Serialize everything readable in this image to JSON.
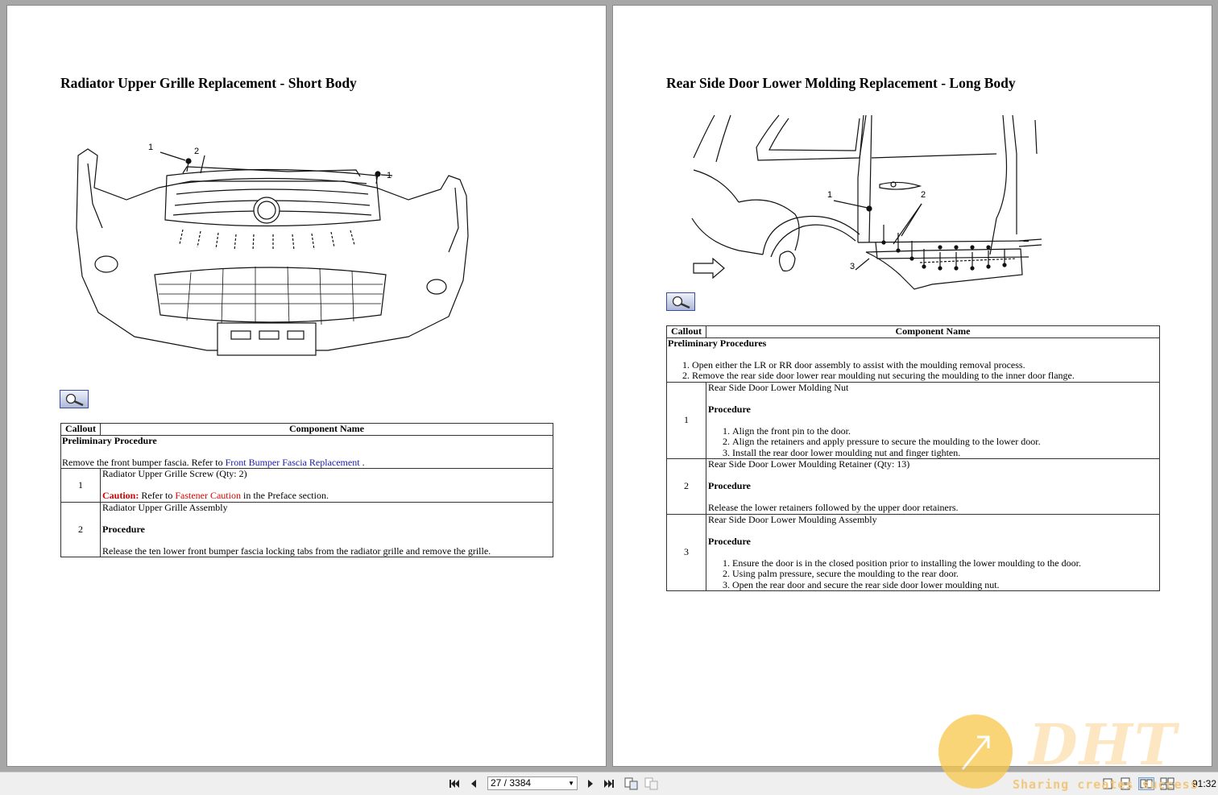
{
  "left_page": {
    "title": "Radiator Upper Grille Replacement - Short Body",
    "figure_callouts": [
      "1",
      "2",
      "1"
    ],
    "table": {
      "headers": [
        "Callout",
        "Component Name"
      ],
      "preliminary_heading": "Preliminary Procedure",
      "preliminary_text_before": "Remove the front bumper fascia. Refer to ",
      "preliminary_link": "Front Bumper Fascia Replacement",
      "preliminary_text_after": " .",
      "rows": [
        {
          "callout": "1",
          "name": "Radiator Upper Grille Screw (Qty: 2)",
          "caution_label": "Caution:",
          "caution_before": " Refer to ",
          "caution_link": "Fastener Caution",
          "caution_after": " in the Preface section."
        },
        {
          "callout": "2",
          "name": "Radiator Upper Grille Assembly",
          "procedure_heading": "Procedure",
          "text": "Release the ten lower front bumper fascia locking tabs from the radiator grille and remove the grille."
        }
      ]
    }
  },
  "right_page": {
    "title": "Rear Side Door Lower Molding Replacement - Long Body",
    "figure_callouts": [
      "1",
      "2",
      "3"
    ],
    "table": {
      "headers": [
        "Callout",
        "Component Name"
      ],
      "preliminary_heading": "Preliminary Procedures",
      "preliminary_steps": [
        "Open either the LR or RR door assembly to assist with the moulding removal process.",
        "Remove the rear side door lower rear moulding nut securing the moulding to the inner door flange."
      ],
      "rows": [
        {
          "callout": "1",
          "name": "Rear Side Door Lower Molding Nut",
          "procedure_heading": "Procedure",
          "steps": [
            "Align the front pin to the door.",
            "Align the retainers and apply pressure to secure the moulding to the lower door.",
            "Install the rear door lower moulding nut and finger tighten."
          ]
        },
        {
          "callout": "2",
          "name": "Rear Side Door Lower Moulding Retainer (Qty: 13)",
          "procedure_heading": "Procedure",
          "text": "Release the lower retainers followed by the upper door retainers."
        },
        {
          "callout": "3",
          "name": "Rear Side Door Lower Moulding Assembly",
          "procedure_heading": "Procedure",
          "steps": [
            "Ensure the door is in the closed position prior to installing the lower moulding to the door.",
            "Using palm pressure, secure the moulding to the rear door.",
            "Open the rear door and secure the rear side door lower moulding nut."
          ]
        }
      ]
    }
  },
  "toolbar": {
    "page_field": "27 / 3384",
    "clock": "91:32",
    "icons": [
      "first-page-icon",
      "prev-page-icon",
      "next-page-icon",
      "last-page-icon",
      "copy-page-icon",
      "paste-page-icon",
      "single-page-view-icon",
      "continuous-view-icon",
      "two-page-view-icon",
      "two-page-continuous-icon"
    ]
  },
  "watermark": {
    "brand": "DHT",
    "tagline": "Sharing creates success"
  },
  "colors": {
    "viewer_bg": "#a7a7a7",
    "link": "#1a1aa6",
    "caution": "#d10000"
  }
}
